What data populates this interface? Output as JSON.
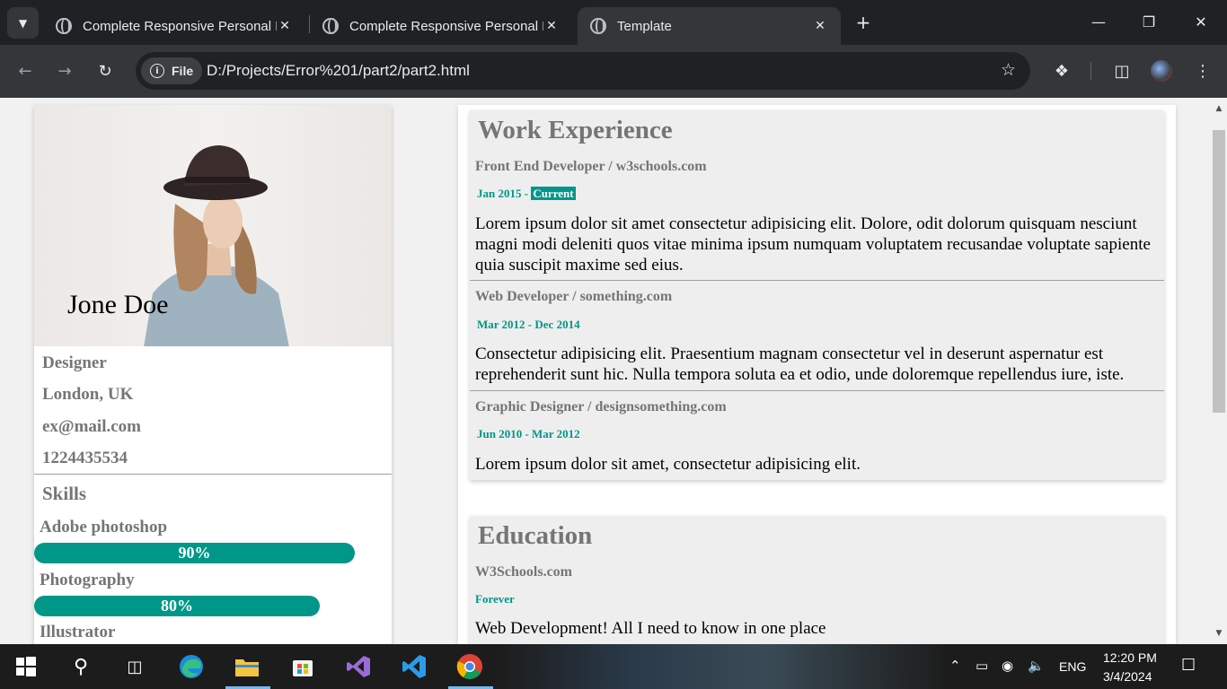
{
  "browser": {
    "tabs": [
      {
        "title": "Complete Responsive Personal P"
      },
      {
        "title": "Complete Responsive Personal P"
      },
      {
        "title": "Template"
      }
    ],
    "address_chip": "File",
    "url": "D:/Projects/Error%201/part2/part2.html"
  },
  "profile": {
    "name": "Jone Doe",
    "title": "Designer",
    "location": "London, UK",
    "email": "ex@mail.com",
    "phone": "1224435534"
  },
  "skills": {
    "heading": "Skills",
    "items": [
      {
        "name": "Adobe photoshop",
        "percent_label": "90%",
        "percent": 90
      },
      {
        "name": "Photography",
        "percent_label": "80%",
        "percent": 80
      },
      {
        "name": "Illustrator"
      }
    ]
  },
  "work": {
    "heading": "Work Experience",
    "jobs": [
      {
        "title": "Front End Developer / w3schools.com",
        "date": "Jan 2015 - ",
        "badge": "Current",
        "description": "Lorem ipsum dolor sit amet consectetur adipisicing elit. Dolore, odit dolorum quisquam nesciunt magni modi deleniti quos vitae minima ipsum numquam voluptatem recusandae voluptate sapiente quia suscipit maxime sed eius."
      },
      {
        "title": "Web Developer / something.com",
        "date": "Mar 2012 - Dec 2014",
        "description": "Consectetur adipisicing elit. Praesentium magnam consectetur vel in deserunt aspernatur est reprehenderit sunt hic. Nulla tempora soluta ea et odio, unde doloremque repellendus iure, iste."
      },
      {
        "title": "Graphic Designer / designsomething.com",
        "date": "Jun 2010 - Mar 2012",
        "description": "Lorem ipsum dolor sit amet, consectetur adipisicing elit."
      }
    ]
  },
  "education": {
    "heading": "Education",
    "school": "W3Schools.com",
    "date": "Forever",
    "description": "Web Development! All I need to know in one place"
  },
  "taskbar": {
    "language": "ENG",
    "time": "12:20 PM",
    "date": "3/4/2024"
  },
  "colors": {
    "accent": "#009688",
    "heading_gray": "#757575",
    "browser_dark": "#202124",
    "browser_toolbar": "#35363a"
  }
}
